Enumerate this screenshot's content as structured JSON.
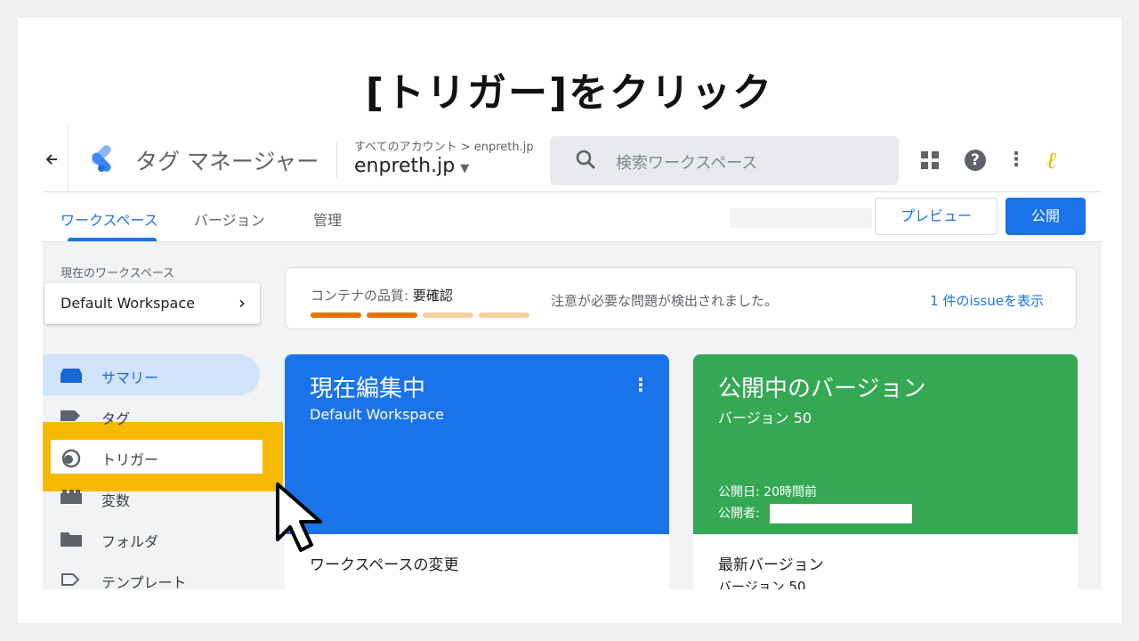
{
  "heading": "[トリガー]をクリック",
  "header": {
    "brand": "タグ マネージャー",
    "breadcrumb": "すべてのアカウント > enpreth.jp",
    "account": "enpreth.jp",
    "search_placeholder": "検索ワークスペース"
  },
  "tabs": [
    {
      "label": "ワークスペース",
      "active": true
    },
    {
      "label": "バージョン",
      "active": false
    },
    {
      "label": "管理",
      "active": false
    }
  ],
  "actions": {
    "preview": "プレビュー",
    "publish": "公開"
  },
  "sidebar": {
    "workspace_label": "現在のワークスペース",
    "workspace_name": "Default Workspace",
    "items": [
      {
        "label": "サマリー",
        "icon": "summary-icon",
        "selected": true
      },
      {
        "label": "タグ",
        "icon": "tag-icon"
      },
      {
        "label": "トリガー",
        "icon": "trigger-icon",
        "highlighted": true
      },
      {
        "label": "変数",
        "icon": "variable-icon"
      },
      {
        "label": "フォルダ",
        "icon": "folder-icon"
      },
      {
        "label": "テンプレート",
        "icon": "template-icon"
      }
    ]
  },
  "quality": {
    "label": "コンテナの品質:",
    "status": "要確認",
    "message": "注意が必要な問題が検出されました。",
    "link": "1 件のissueを表示"
  },
  "editing_card": {
    "title": "現在編集中",
    "subtitle": "Default Workspace",
    "bottom_title": "ワークスペースの変更"
  },
  "published_card": {
    "title": "公開中のバージョン",
    "subtitle": "バージョン 50",
    "published_date": "公開日: 20時間前",
    "published_by": "公開者:",
    "bottom_title": "最新バージョン",
    "bottom_sub": "バージョン 50"
  },
  "colors": {
    "accent": "#1a73e8",
    "green": "#34a853",
    "highlight": "#f7b900",
    "quality_strong": "#e37400",
    "quality_weak": "#f6cfa0"
  }
}
